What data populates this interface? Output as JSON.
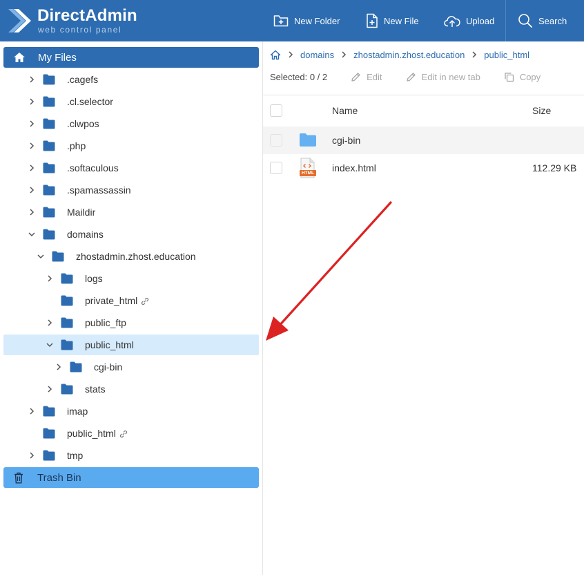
{
  "header": {
    "brand_title": "DirectAdmin",
    "brand_subtitle": "web control panel",
    "buttons": {
      "new_folder": "New Folder",
      "new_file": "New File",
      "upload": "Upload",
      "search": "Search"
    },
    "colors": {
      "background": "#2d6cb0"
    }
  },
  "sidebar": {
    "my_files": "My Files",
    "tree": [
      {
        "label": ".cagefs",
        "expand": "collapsed"
      },
      {
        "label": ".cl.selector",
        "expand": "collapsed"
      },
      {
        "label": ".clwpos",
        "expand": "collapsed"
      },
      {
        "label": ".php",
        "expand": "collapsed"
      },
      {
        "label": ".softaculous",
        "expand": "collapsed"
      },
      {
        "label": ".spamassassin",
        "expand": "collapsed"
      },
      {
        "label": "Maildir",
        "expand": "collapsed"
      },
      {
        "label": "domains",
        "expand": "expanded"
      },
      {
        "label": "zhostadmin.zhost.education",
        "expand": "expanded"
      },
      {
        "label": "logs",
        "expand": "collapsed"
      },
      {
        "label": "private_html",
        "expand": "none",
        "symlink": true
      },
      {
        "label": "public_ftp",
        "expand": "collapsed"
      },
      {
        "label": "public_html",
        "expand": "expanded",
        "selected": true
      },
      {
        "label": "cgi-bin",
        "expand": "collapsed"
      },
      {
        "label": "stats",
        "expand": "collapsed"
      },
      {
        "label": "imap",
        "expand": "collapsed"
      },
      {
        "label": "public_html",
        "expand": "none",
        "symlink": true
      },
      {
        "label": "tmp",
        "expand": "collapsed"
      }
    ],
    "trash": "Trash Bin",
    "colors": {
      "active": "#2d6cb0",
      "selected_row": "#d6ebfb",
      "trash": "#5aaaf0"
    }
  },
  "main": {
    "breadcrumb": [
      "domains",
      "zhostadmin.zhost.education",
      "public_html"
    ],
    "toolbar": {
      "selected_label": "Selected:",
      "selected_count": "0 / 2",
      "edit": "Edit",
      "edit_new_tab": "Edit in new tab",
      "copy": "Copy"
    },
    "columns": {
      "name": "Name",
      "size": "Size"
    },
    "files": [
      {
        "name": "cgi-bin",
        "size": "",
        "icon": "folder-icon"
      },
      {
        "name": "index.html",
        "size": "112.29 KB",
        "icon": "html-file-icon"
      }
    ],
    "html_badge": "HTML"
  },
  "annotation": {
    "arrow_color": "#dd2222",
    "points_to": "public_html"
  }
}
